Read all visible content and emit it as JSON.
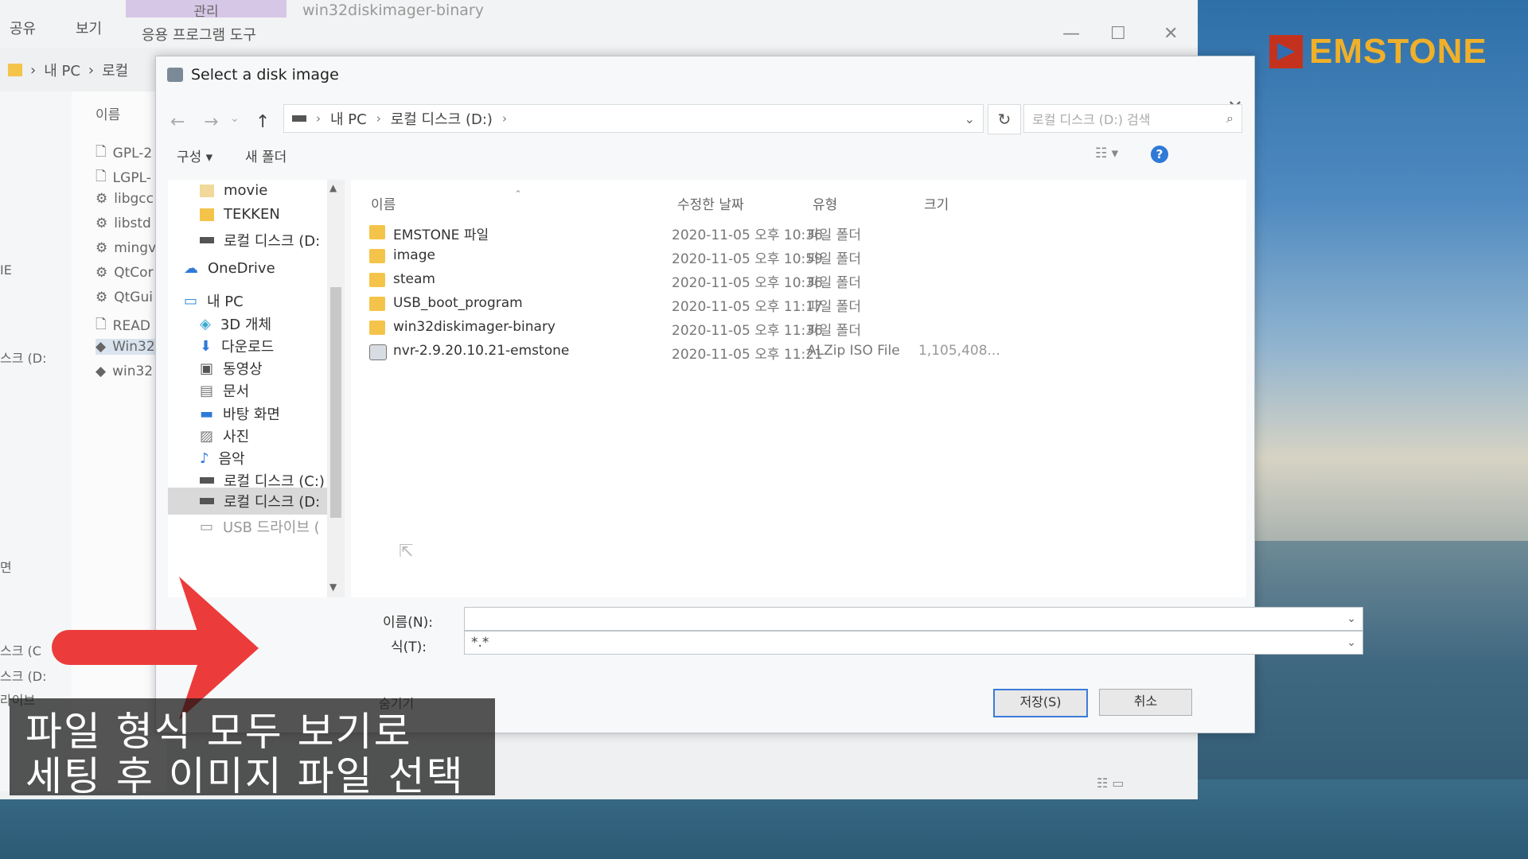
{
  "brand": {
    "logo_text": "EMSTONE",
    "colors": {
      "text": "#f0b02a",
      "mark_red": "#c4321e",
      "mark_blue": "#2f6db0"
    }
  },
  "explorer": {
    "tabs": [
      "공유",
      "보기"
    ],
    "manage_tab": "관리",
    "app_tools_tab": "응용 프로그램 도구",
    "title": "win32diskimager-binary",
    "address": [
      "내 PC",
      "로컬"
    ],
    "list_header": "이름",
    "files": [
      "GPL-2",
      "LGPL-",
      "libgcc",
      "libstd",
      "mingv",
      "QtCor",
      "QtGui",
      "READ",
      "Win32",
      "win32"
    ],
    "nav": [
      "IE",
      "스크 (D:",
      "면",
      "스크 (C",
      "스크 (D:",
      "라이브"
    ]
  },
  "dialog": {
    "title": "Select a disk image",
    "icon": "disk-imager-icon",
    "address": {
      "drive_icon": "drive-icon",
      "crumbs": [
        "내 PC",
        "로컬 디스크 (D:)"
      ]
    },
    "search_placeholder": "로컬 디스크 (D:) 검색",
    "commands": {
      "organize": "구성 ▾",
      "new_folder": "새 폴더"
    },
    "nav_items": [
      {
        "label": "movie",
        "icon": "folder-icon"
      },
      {
        "label": "TEKKEN",
        "icon": "folder-icon"
      },
      {
        "label": "로컬 디스크 (D:",
        "icon": "drive-icon"
      },
      {
        "label": "OneDrive",
        "icon": "onedrive-icon"
      },
      {
        "label": "내 PC",
        "icon": "pc-icon"
      },
      {
        "label": "3D 개체",
        "icon": "3d-objects-icon"
      },
      {
        "label": "다운로드",
        "icon": "download-icon"
      },
      {
        "label": "동영상",
        "icon": "video-icon"
      },
      {
        "label": "문서",
        "icon": "document-icon"
      },
      {
        "label": "바탕 화면",
        "icon": "desktop-icon"
      },
      {
        "label": "사진",
        "icon": "pictures-icon"
      },
      {
        "label": "음악",
        "icon": "music-icon"
      },
      {
        "label": "로컬 디스크 (C:)",
        "icon": "drive-icon"
      },
      {
        "label": "로컬 디스크 (D:",
        "icon": "drive-icon"
      },
      {
        "label": "USB 드라이브 (",
        "icon": "usb-icon"
      }
    ],
    "columns": [
      "이름",
      "수정한 날짜",
      "유형",
      "크기"
    ],
    "files": [
      {
        "name": "EMSTONE 파일",
        "date": "2020-11-05 오후 10:36",
        "type": "파일 폴더",
        "size": ""
      },
      {
        "name": "image",
        "date": "2020-11-05 오후 10:59",
        "type": "파일 폴더",
        "size": ""
      },
      {
        "name": "steam",
        "date": "2020-11-05 오후 10:36",
        "type": "파일 폴더",
        "size": ""
      },
      {
        "name": "USB_boot_program",
        "date": "2020-11-05 오후 11:17",
        "type": "파일 폴더",
        "size": ""
      },
      {
        "name": "win32diskimager-binary",
        "date": "2020-11-05 오후 11:36",
        "type": "파일 폴더",
        "size": ""
      },
      {
        "name": "nvr-2.9.20.10.21-emstone",
        "date": "2020-11-05 오후 11:21",
        "type": "ALZip ISO File",
        "size": "1,105,408..."
      }
    ],
    "filename_label": "이름(N):",
    "filename_value": "",
    "filetype_label": "식(T):",
    "filetype_value": "*.*",
    "save_button": "저장(S)",
    "cancel_button": "취소",
    "hide_folders": "숨기기"
  },
  "caption": {
    "line1": "파일 형식 모두 보기로",
    "line2": "세팅 후 이미지 파일 선택"
  }
}
